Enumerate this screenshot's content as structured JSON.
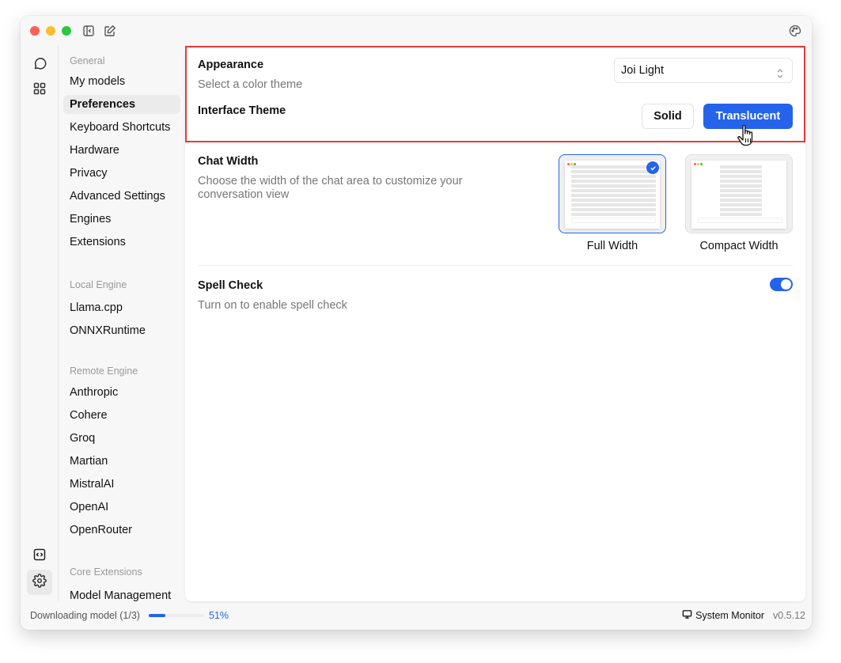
{
  "titlebar": {
    "icons": [
      "close-dot",
      "minimize-dot",
      "maximize-dot",
      "sidebar-toggle-icon",
      "new-chat-icon",
      "palette-icon"
    ]
  },
  "rail": {
    "items": [
      {
        "name": "chat",
        "icon": "chat-bubble-icon"
      },
      {
        "name": "hub",
        "icon": "grid-icon"
      },
      {
        "name": "local-api",
        "icon": "code-icon"
      },
      {
        "name": "settings",
        "icon": "gear-icon",
        "active": true
      }
    ]
  },
  "settings_nav": {
    "groups": [
      {
        "title": "General",
        "items": [
          "My models",
          "Preferences",
          "Keyboard Shortcuts",
          "Hardware",
          "Privacy",
          "Advanced Settings",
          "Engines",
          "Extensions"
        ]
      },
      {
        "title": "Local Engine",
        "items": [
          "Llama.cpp",
          "ONNXRuntime"
        ]
      },
      {
        "title": "Remote Engine",
        "items": [
          "Anthropic",
          "Cohere",
          "Groq",
          "Martian",
          "MistralAI",
          "OpenAI",
          "OpenRouter"
        ]
      },
      {
        "title": "Core Extensions",
        "items": [
          "Model Management"
        ]
      }
    ],
    "active_item": "Preferences"
  },
  "appearance": {
    "title": "Appearance",
    "description": "Select a color theme",
    "theme_select_value": "Joi Light",
    "interface_theme_title": "Interface Theme",
    "solid_label": "Solid",
    "translucent_label": "Translucent",
    "selected_interface_theme": "Translucent"
  },
  "chat_width": {
    "title": "Chat Width",
    "description": "Choose the width of the chat area to customize your conversation view",
    "options": [
      {
        "label": "Full Width",
        "selected": true
      },
      {
        "label": "Compact Width",
        "selected": false
      }
    ]
  },
  "spell_check": {
    "title": "Spell Check",
    "description": "Turn on to enable spell check",
    "enabled": true
  },
  "statusbar": {
    "download_text": "Downloading model (1/3)",
    "progress_percent": 51,
    "progress_label": "51%",
    "system_monitor_label": "System Monitor",
    "version": "v0.5.12"
  },
  "colors": {
    "accent": "#2563eb",
    "highlight_border": "#e5393a",
    "traffic_red": "#fe5f57",
    "traffic_yellow": "#febc2e",
    "traffic_green": "#28c840"
  }
}
